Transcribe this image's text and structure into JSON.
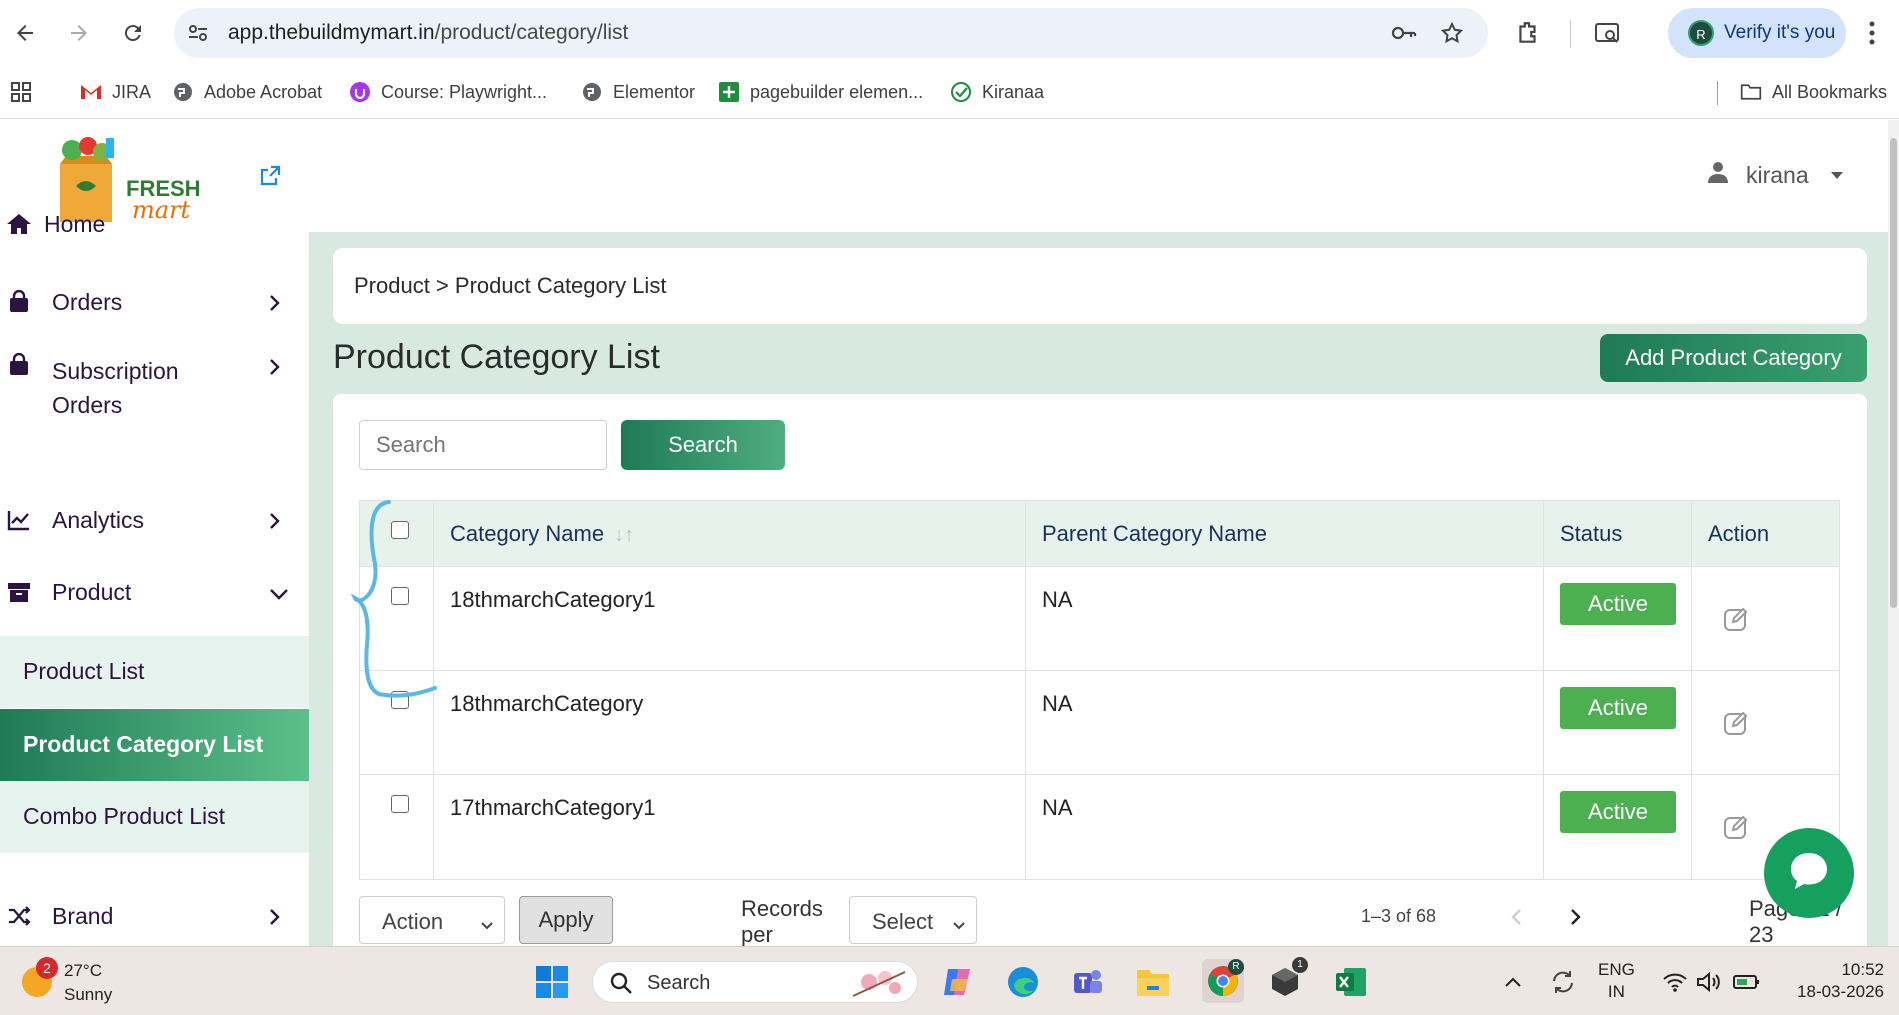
{
  "browser": {
    "url_domain": "app.thebuildmymart.in",
    "url_path": "/product/category/list",
    "verify_label": "Verify it's you",
    "verify_avatar": "R",
    "bookmarks": [
      "JIRA",
      "Adobe Acrobat",
      "Course: Playwright...",
      "Elementor",
      "pagebuilder elemen...",
      "Kiranaa"
    ],
    "all_bookmarks": "All Bookmarks"
  },
  "brand": {
    "logo_line1": "FRESH",
    "logo_line2": "mart"
  },
  "user": {
    "name": "kirana"
  },
  "sidebar": {
    "items": [
      {
        "label": "Home",
        "icon": "home-icon"
      },
      {
        "label": "Orders",
        "icon": "bag-icon"
      },
      {
        "label": "Subscription Orders",
        "line1": "Subscription",
        "line2": "Orders",
        "icon": "bag-icon"
      },
      {
        "label": "Analytics",
        "icon": "chart-line-icon"
      },
      {
        "label": "Product",
        "icon": "archive-icon"
      },
      {
        "label": "Brand",
        "icon": "shuffle-icon"
      }
    ],
    "sub_items": [
      {
        "label": "Product List"
      },
      {
        "label": "Product Category List"
      },
      {
        "label": "Combo Product List"
      }
    ]
  },
  "main": {
    "breadcrumb": "Product > Product Category List",
    "title": "Product Category List",
    "add_button": "Add Product Category",
    "search_placeholder": "Search",
    "search_button": "Search",
    "table": {
      "headers": [
        "Category Name",
        "Parent Category Name",
        "Status",
        "Action"
      ],
      "rows": [
        {
          "name": "18thmarchCategory1",
          "parent": "NA",
          "status": "Active"
        },
        {
          "name": "18thmarchCategory",
          "parent": "NA",
          "status": "Active"
        },
        {
          "name": "17thmarchCategory1",
          "parent": "NA",
          "status": "Active"
        }
      ]
    },
    "bulk_action": "Action",
    "apply": "Apply",
    "records_label": "Records per",
    "records_select": "Select",
    "range": "1–3 of 68",
    "pages": "Pages:1 / 23"
  },
  "taskbar": {
    "weather_temp": "27°C",
    "weather_desc": "Sunny",
    "weather_badge": "2",
    "search_label": "Search",
    "lang_line1": "ENG",
    "lang_line2": "IN",
    "time": "10:52",
    "date": "18-03-2026",
    "chrome_badge": "R",
    "app_badge": "1"
  },
  "colors": {
    "brand_green": "#1f7a56",
    "status_green": "#4caf50",
    "panel_bg": "#d7e9e1",
    "nav_text": "#2b1540"
  }
}
